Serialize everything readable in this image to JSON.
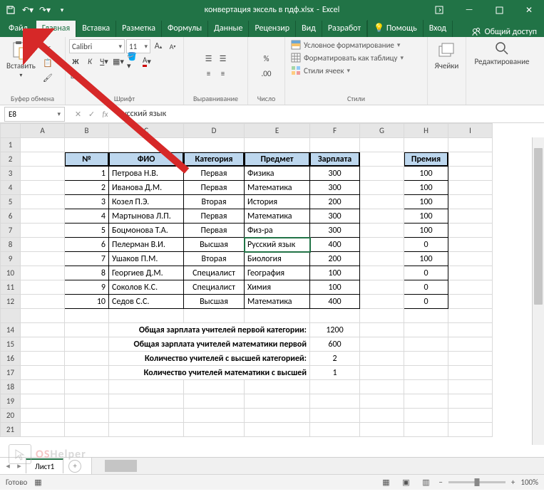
{
  "title": {
    "filename": "конвертация эксель в пдф.xlsx",
    "app": "Excel"
  },
  "tabs": {
    "file": "Файл",
    "home": "Главная",
    "insert": "Вставка",
    "layout": "Разметка",
    "formulas": "Формулы",
    "data": "Данные",
    "review": "Рецензир",
    "view": "Вид",
    "developer": "Разработ",
    "help": "Помощь",
    "login": "Вход",
    "share": "Общий доступ"
  },
  "ribbon": {
    "clipboard": {
      "label": "Буфер обмена",
      "paste": "Вставить"
    },
    "font": {
      "label": "Шрифт",
      "name": "Calibri",
      "size": "11"
    },
    "alignment": {
      "label": "Выравнивание"
    },
    "number": {
      "label": "Число"
    },
    "styles": {
      "label": "Стили",
      "cond": "Условное форматирование",
      "table": "Форматировать как таблицу",
      "cell": "Стили ячеек"
    },
    "cells": {
      "label": "Ячейки"
    },
    "editing": {
      "label": "Редактирование"
    }
  },
  "formulabar": {
    "ref": "E8",
    "value": "Русский язык"
  },
  "columns": [
    "A",
    "B",
    "C",
    "D",
    "E",
    "F",
    "G",
    "H",
    "I"
  ],
  "headers": {
    "num": "№",
    "fio": "ФИО",
    "cat": "Категория",
    "subj": "Предмет",
    "sal": "Зарплата",
    "bonus": "Премия"
  },
  "rows": [
    {
      "n": "1",
      "fio": "Петрова Н.В.",
      "cat": "Первая",
      "subj": "Физика",
      "sal": "300",
      "bonus": "100"
    },
    {
      "n": "2",
      "fio": "Иванова Д.М.",
      "cat": "Первая",
      "subj": "Математика",
      "sal": "300",
      "bonus": "100"
    },
    {
      "n": "3",
      "fio": "Козел П.Э.",
      "cat": "Вторая",
      "subj": "История",
      "sal": "200",
      "bonus": "100"
    },
    {
      "n": "4",
      "fio": "Мартынова Л.П.",
      "cat": "Первая",
      "subj": "Математика",
      "sal": "300",
      "bonus": "100"
    },
    {
      "n": "5",
      "fio": "Боцмонова Т.А.",
      "cat": "Первая",
      "subj": "Физ-ра",
      "sal": "300",
      "bonus": "100"
    },
    {
      "n": "6",
      "fio": "Пелерман В.И.",
      "cat": "Высшая",
      "subj": "Русский язык",
      "sal": "400",
      "bonus": "0"
    },
    {
      "n": "7",
      "fio": "Ушаков П.М.",
      "cat": "Вторая",
      "subj": "Биология",
      "sal": "200",
      "bonus": "100"
    },
    {
      "n": "8",
      "fio": "Георгиев Д.М.",
      "cat": "Специалист",
      "subj": "География",
      "sal": "100",
      "bonus": "0"
    },
    {
      "n": "9",
      "fio": "Соколов К.С.",
      "cat": "Специалист",
      "subj": "Химия",
      "sal": "100",
      "bonus": "0"
    },
    {
      "n": "10",
      "fio": "Седов С.С.",
      "cat": "Высшая",
      "subj": "Математика",
      "sal": "400",
      "bonus": "0"
    }
  ],
  "summary": [
    {
      "label": "Общая зарплата учителей первой категории:",
      "val": "1200"
    },
    {
      "label": "Общая зарплата учителей математики первой",
      "val": "600"
    },
    {
      "label": "Количество учителей с высшей категорией:",
      "val": "2"
    },
    {
      "label": "Количество учителей математики с высшей",
      "val": "1"
    }
  ],
  "sheet": {
    "tab": "Лист1"
  },
  "status": {
    "ready": "Готово",
    "zoom": "100%"
  },
  "watermark": {
    "text1": "OS",
    "text2": "Helper"
  }
}
